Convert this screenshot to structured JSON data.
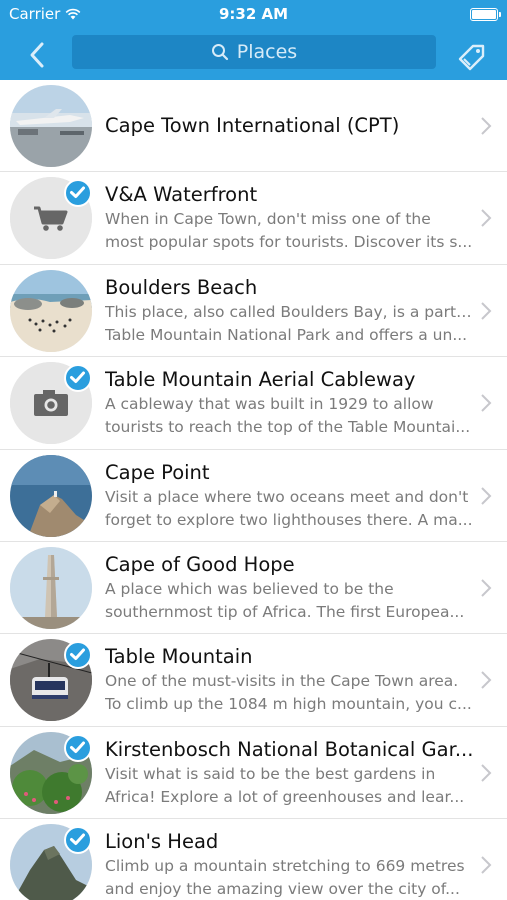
{
  "status_bar": {
    "carrier": "Carrier",
    "time": "9:32 AM"
  },
  "navbar": {
    "search_placeholder": "Places"
  },
  "colors": {
    "accent": "#2a9ede",
    "search_bg": "#1d86c5"
  },
  "places": [
    {
      "title": "Cape Town International (CPT)",
      "desc1": "",
      "desc2": "",
      "checked": false,
      "thumb": "airport-photo"
    },
    {
      "title": "V&A Waterfront",
      "desc1": "When in Cape Town, don't miss one of the",
      "desc2": "most popular spots for tourists. Discover its s...",
      "checked": true,
      "thumb": "cart-icon"
    },
    {
      "title": "Boulders Beach",
      "desc1": "This place, also called Boulders Bay, is a part of",
      "desc2": "Table Mountain National Park and offers a un...",
      "checked": false,
      "thumb": "beach-photo"
    },
    {
      "title": "Table Mountain Aerial Cableway",
      "desc1": "A cableway that was built in 1929 to allow",
      "desc2": "tourists to reach the top of the Table Mountai...",
      "checked": true,
      "thumb": "camera-icon"
    },
    {
      "title": "Cape Point",
      "desc1": "Visit a place where two oceans meet and don't",
      "desc2": "forget to explore two lighthouses there. A ma...",
      "checked": false,
      "thumb": "cliff-photo"
    },
    {
      "title": "Cape of Good Hope",
      "desc1": "A place which was believed to be the",
      "desc2": "southernmost tip of Africa. The first Europea...",
      "checked": false,
      "thumb": "monument-photo"
    },
    {
      "title": "Table Mountain",
      "desc1": "One of the must-visits in the Cape Town area.",
      "desc2": "To climb up the 1084 m high mountain, you c...",
      "checked": true,
      "thumb": "cablecar-photo"
    },
    {
      "title": "Kirstenbosch National Botanical Gar...",
      "desc1": "Visit what is said to be the best gardens in",
      "desc2": "Africa! Explore a lot of greenhouses and lear...",
      "checked": true,
      "thumb": "garden-photo"
    },
    {
      "title": "Lion's Head",
      "desc1": "Climb up a mountain stretching to 669 metres",
      "desc2": "and enjoy the amazing view over the city of...",
      "checked": true,
      "thumb": "peak-photo"
    }
  ]
}
